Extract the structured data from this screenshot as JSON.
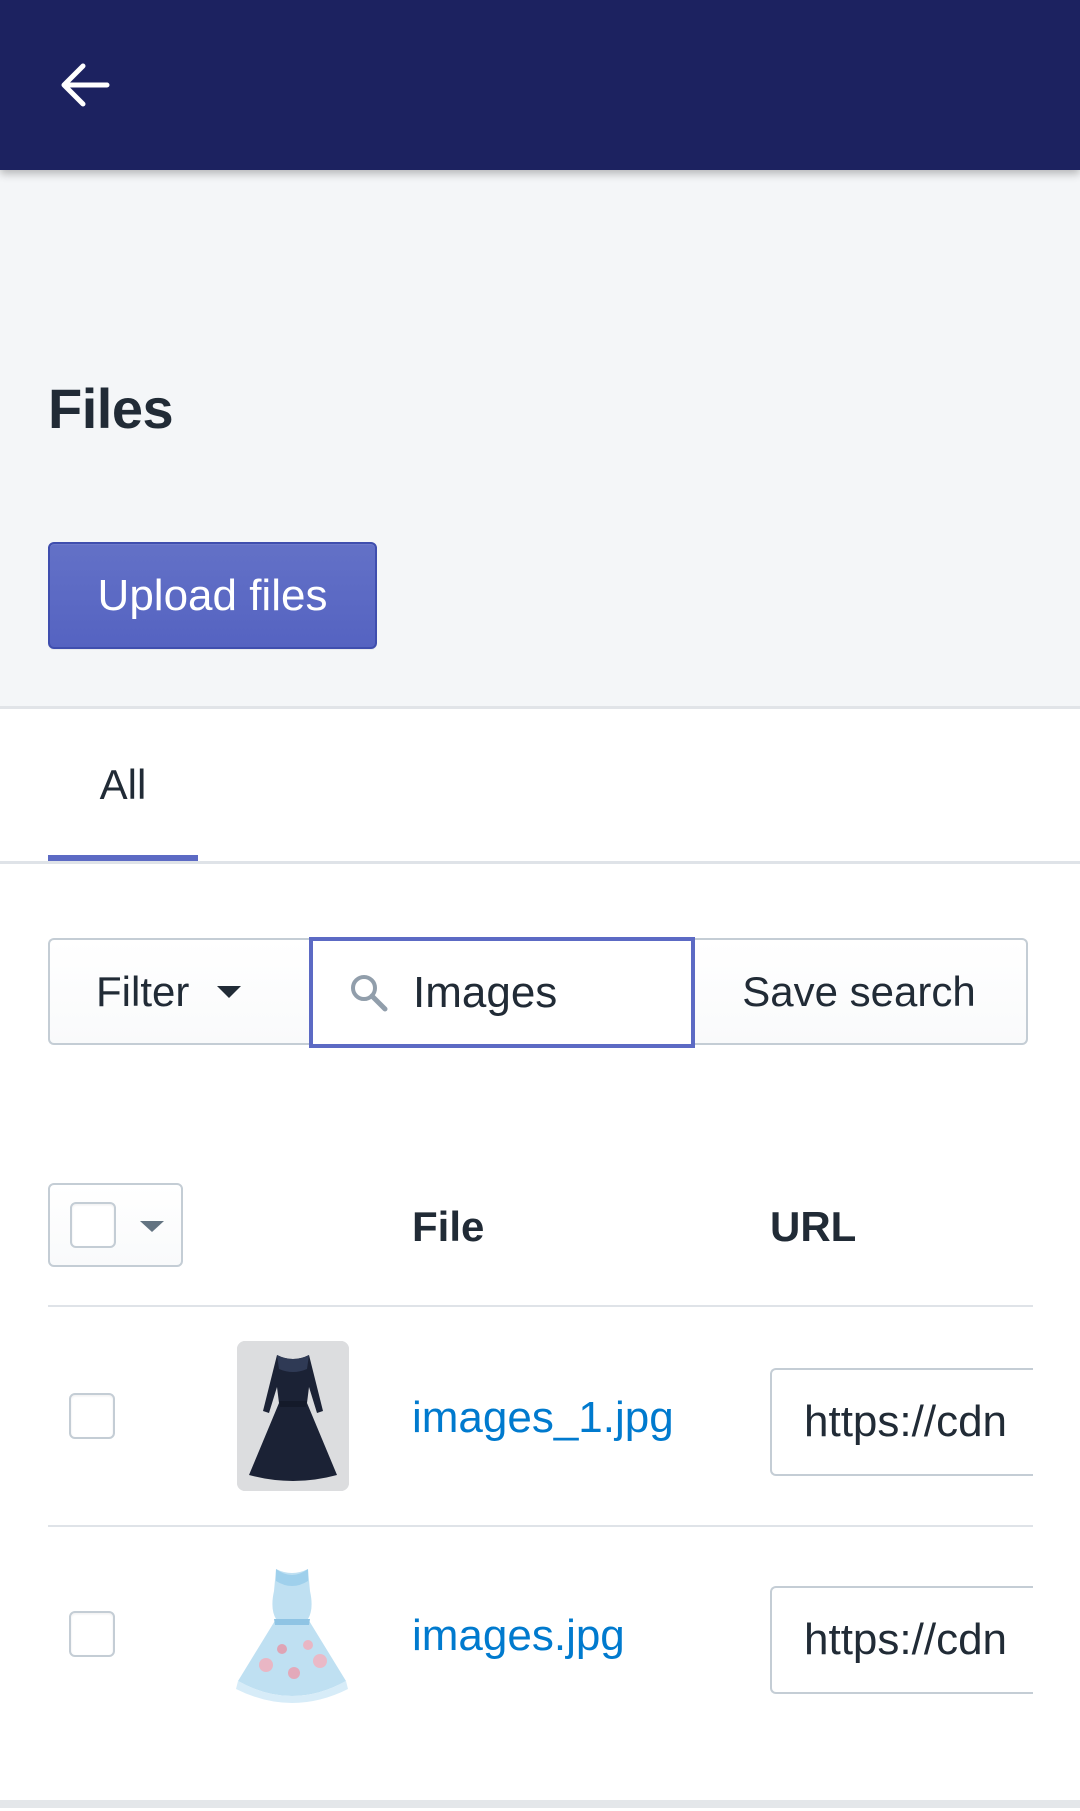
{
  "header": {
    "back_icon": "arrow-left-icon",
    "bar_color": "#1c2260"
  },
  "page": {
    "title": "Files"
  },
  "actions": {
    "upload_label": "Upload files",
    "accent_color": "#5c6ac4"
  },
  "tabs": [
    {
      "label": "All",
      "selected": true
    }
  ],
  "toolbar": {
    "filter_label": "Filter",
    "search_value": "Images",
    "search_icon": "search-icon",
    "save_search_label": "Save search"
  },
  "table": {
    "columns": [
      "File",
      "URL"
    ],
    "rows": [
      {
        "file_name": "images_1.jpg",
        "url": "https://cdn",
        "thumbnail": "dark-navy-dress"
      },
      {
        "file_name": "images.jpg",
        "url": "https://cdn",
        "thumbnail": "light-blue-floral-dress"
      }
    ]
  },
  "colors": {
    "link": "#007ace",
    "text": "#212b36",
    "background": "#f4f6f8"
  }
}
